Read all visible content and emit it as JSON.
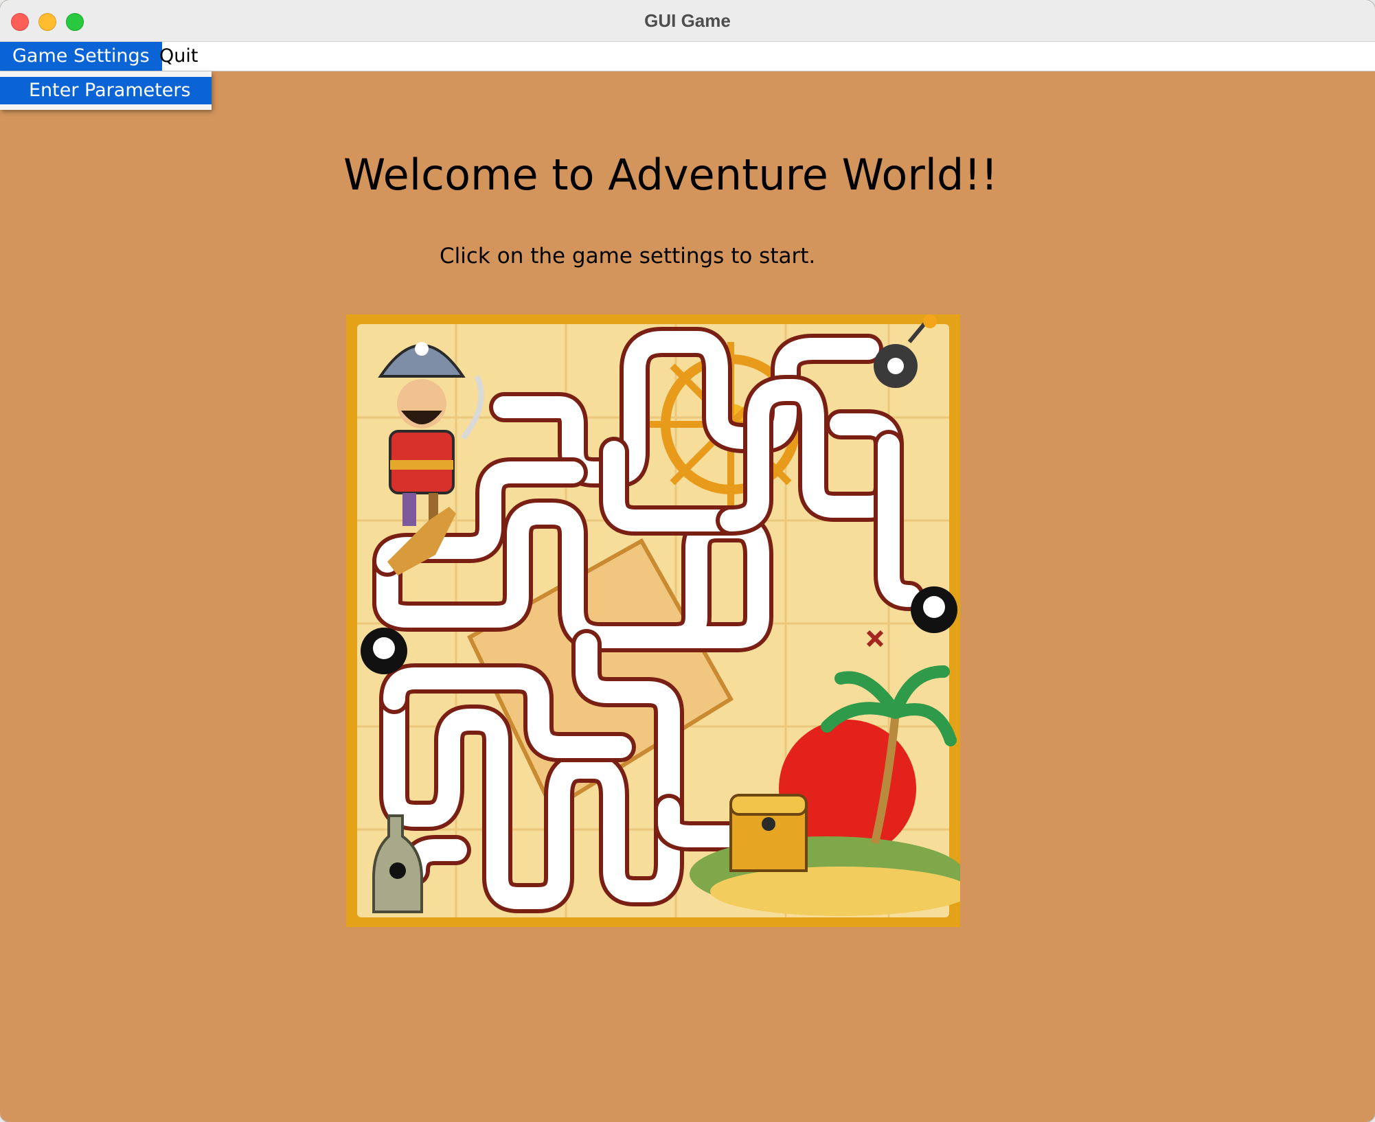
{
  "window": {
    "title": "GUI Game"
  },
  "menubar": {
    "items": [
      {
        "label": "Game Settings",
        "active": true
      },
      {
        "label": "Quit",
        "active": false
      }
    ],
    "dropdown": {
      "items": [
        {
          "label": "Enter Parameters",
          "highlighted": true
        }
      ]
    }
  },
  "main": {
    "heading": "Welcome to Adventure World!!",
    "subtitle": "Click on the game settings to start.",
    "image": {
      "subject": "pirate treasure maze illustration"
    }
  },
  "colors": {
    "background": "#d4955c",
    "menu_highlight": "#0a64d6",
    "maze_border": "#e3a217",
    "maze_paper": "#f7dd9a"
  }
}
